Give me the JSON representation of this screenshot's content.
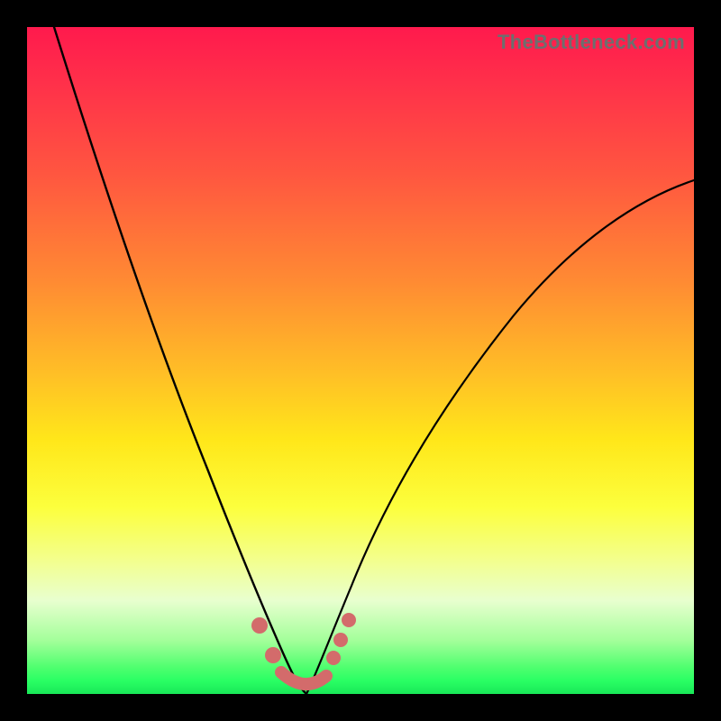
{
  "watermark": "TheBottleneck.com",
  "chart_data": {
    "type": "line",
    "title": "",
    "xlabel": "",
    "ylabel": "",
    "xlim": [
      0,
      100
    ],
    "ylim": [
      0,
      100
    ],
    "series": [
      {
        "name": "left-curve",
        "x": [
          4,
          10,
          16,
          22,
          28,
          32,
          36,
          38,
          40
        ],
        "y": [
          100,
          80,
          58,
          38,
          20,
          10,
          4,
          1,
          0
        ]
      },
      {
        "name": "right-curve",
        "x": [
          40,
          42,
          46,
          52,
          60,
          70,
          82,
          94,
          100
        ],
        "y": [
          0,
          2,
          8,
          18,
          32,
          48,
          62,
          72,
          76
        ]
      }
    ],
    "markers": {
      "name": "bottom-dots",
      "points": [
        {
          "x": 34.5,
          "y": 10
        },
        {
          "x": 36.5,
          "y": 5.5
        },
        {
          "x": 38,
          "y": 2
        },
        {
          "x": 40,
          "y": 0.5
        },
        {
          "x": 42,
          "y": 0.5
        },
        {
          "x": 44,
          "y": 2.5
        },
        {
          "x": 45.2,
          "y": 5.5
        },
        {
          "x": 46.2,
          "y": 8.5
        },
        {
          "x": 47.2,
          "y": 12
        }
      ]
    },
    "background_gradient": {
      "top": "#ff1a4d",
      "mid_upper": "#ff8a33",
      "mid": "#ffe71a",
      "mid_lower": "#e8ffcf",
      "bottom": "#19e858"
    }
  }
}
